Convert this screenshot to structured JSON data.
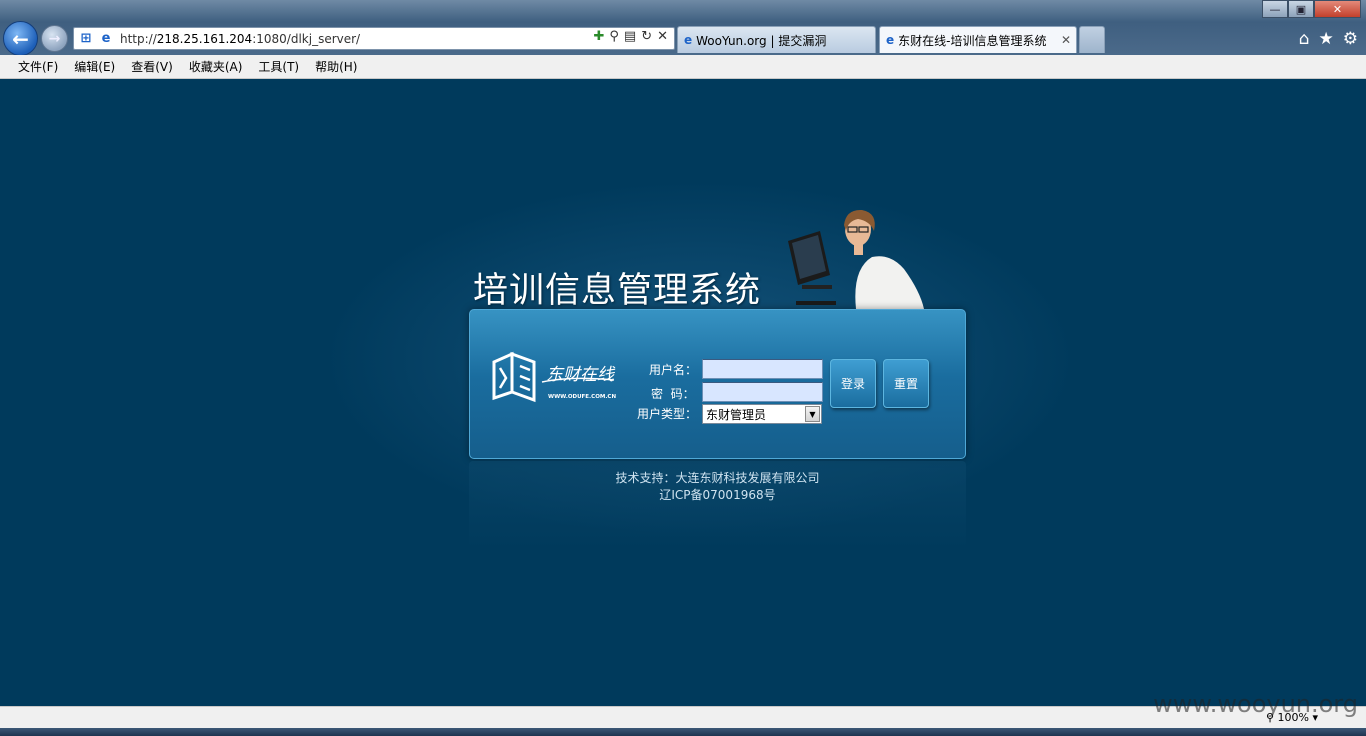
{
  "browser": {
    "url_prefix": "http://",
    "url_host": "218.25.161.204",
    "url_rest": ":1080/dlkj_server/",
    "tabs": [
      {
        "label": "WooYun.org | 提交漏洞"
      },
      {
        "label": "东财在线-培训信息管理系统"
      }
    ],
    "menu": [
      "文件(F)",
      "编辑(E)",
      "查看(V)",
      "收藏夹(A)",
      "工具(T)",
      "帮助(H)"
    ],
    "zoom": "100%"
  },
  "page": {
    "title": "培训信息管理系统",
    "logo_text": "东财在线",
    "logo_domain": "WWW.ODUFE.COM.CN",
    "form": {
      "username_label": "用户名：",
      "password_label": "密  码：",
      "usertype_label": "用户类型：",
      "usertype_value": "东财管理员",
      "login_label": "登录",
      "reset_label": "重置"
    },
    "footer": {
      "support": "技术支持：大连东财科技发展有限公司",
      "icp": "辽ICP备07001968号"
    }
  },
  "watermark": "www.wooyun.org",
  "colors": {
    "background": "#003a5c",
    "panel": "#1a6d9f",
    "field": "#d8e6ff"
  }
}
